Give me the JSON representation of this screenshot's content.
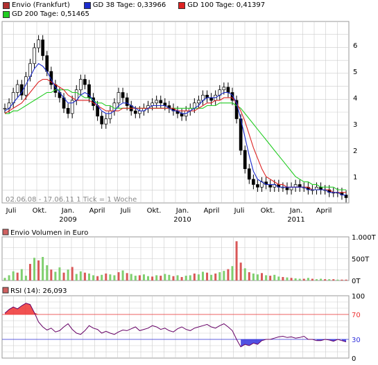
{
  "legend": {
    "row1": [
      {
        "label": "Envio (Frankfurt)",
        "color": "#b03030"
      },
      {
        "label": "GD 38 Tage: 0,33966",
        "color": "#1c2ccd"
      },
      {
        "label": "GD 100 Tage: 0,41397",
        "color": "#dd2222"
      }
    ],
    "row2": [
      {
        "label": "GD 200 Tage: 0,51465",
        "color": "#22cc22"
      }
    ]
  },
  "price_note": "02.06.08 - 17.06.11   1 Tick = 1 Woche",
  "volume_title": "Envio Volumen in Euro",
  "rsi_title": "RSI (14): 26,093",
  "colors": {
    "grid": "#cccccc",
    "border": "#999999",
    "candle": "#000000",
    "gd38": "#1c2ccd",
    "gd100": "#dd2222",
    "gd200": "#22cc22",
    "vol_up": "#7fcf6f",
    "vol_down": "#d95757",
    "rsi": "#660066",
    "rsi_over": "#ee3333",
    "rsi_under": "#3333dd"
  },
  "chart_data": [
    {
      "type": "line",
      "name": "price",
      "x_tick_labels": [
        "Juli",
        "Okt.",
        "Jan.",
        "April",
        "Juli",
        "Okt.",
        "Jan.",
        "April",
        "Juli",
        "Okt.",
        "Jan.",
        "April"
      ],
      "x_year_labels": [
        "2009",
        "2010",
        "2011"
      ],
      "y_ticks": [
        1,
        2,
        3,
        4,
        5,
        6
      ],
      "ylim": [
        0,
        6.9
      ],
      "series": [
        {
          "name": "Envio (Frankfurt)",
          "values": [
            3.6,
            3.8,
            4.2,
            4.5,
            4.1,
            4.8,
            5.3,
            5.9,
            6.2,
            5.6,
            5.0,
            4.5,
            4.2,
            4.0,
            3.6,
            3.4,
            3.9,
            4.3,
            4.7,
            4.5,
            4.0,
            3.7,
            3.3,
            3.0,
            3.2,
            3.5,
            3.8,
            4.2,
            4.0,
            3.7,
            3.5,
            3.4,
            3.5,
            3.6,
            3.7,
            3.8,
            3.9,
            3.8,
            3.7,
            3.6,
            3.5,
            3.4,
            3.3,
            3.5,
            3.6,
            3.8,
            3.9,
            4.1,
            4.0,
            3.9,
            4.1,
            4.3,
            4.4,
            4.2,
            3.9,
            3.2,
            2.0,
            1.3,
            0.9,
            0.7,
            0.6,
            0.8,
            0.7,
            0.6,
            0.7,
            0.6,
            0.6,
            0.5,
            0.6,
            0.7,
            0.6,
            0.6,
            0.5,
            0.5,
            0.6,
            0.5,
            0.5,
            0.4,
            0.4,
            0.4,
            0.3,
            0.2
          ]
        },
        {
          "name": "GD 38 Tage",
          "values": [
            3.5,
            3.6,
            3.8,
            4.0,
            4.2,
            4.5,
            4.8,
            5.1,
            5.3,
            5.2,
            5.0,
            4.7,
            4.4,
            4.2,
            4.0,
            3.8,
            3.8,
            3.9,
            4.1,
            4.2,
            4.1,
            3.9,
            3.7,
            3.5,
            3.4,
            3.4,
            3.5,
            3.7,
            3.8,
            3.8,
            3.7,
            3.6,
            3.5,
            3.5,
            3.6,
            3.7,
            3.7,
            3.7,
            3.7,
            3.6,
            3.5,
            3.5,
            3.4,
            3.4,
            3.5,
            3.6,
            3.7,
            3.9,
            4.0,
            4.0,
            4.0,
            4.1,
            4.2,
            4.2,
            4.1,
            3.8,
            3.2,
            2.5,
            1.8,
            1.2,
            0.9,
            0.8,
            0.7,
            0.7,
            0.7,
            0.6,
            0.6,
            0.6,
            0.6,
            0.6,
            0.6,
            0.6,
            0.5,
            0.5,
            0.5,
            0.5,
            0.5,
            0.4,
            0.4,
            0.4,
            0.3,
            0.3
          ]
        },
        {
          "name": "GD 100 Tage",
          "values": [
            3.4,
            3.5,
            3.6,
            3.7,
            3.8,
            4.0,
            4.2,
            4.4,
            4.6,
            4.7,
            4.7,
            4.6,
            4.5,
            4.4,
            4.3,
            4.1,
            4.0,
            3.9,
            3.9,
            3.9,
            3.9,
            3.8,
            3.7,
            3.6,
            3.5,
            3.5,
            3.5,
            3.5,
            3.6,
            3.6,
            3.6,
            3.6,
            3.6,
            3.6,
            3.6,
            3.6,
            3.6,
            3.6,
            3.6,
            3.6,
            3.6,
            3.5,
            3.5,
            3.5,
            3.5,
            3.5,
            3.6,
            3.7,
            3.8,
            3.8,
            3.9,
            3.9,
            4.0,
            4.0,
            4.0,
            3.8,
            3.5,
            3.1,
            2.6,
            2.1,
            1.7,
            1.3,
            1.0,
            0.9,
            0.8,
            0.7,
            0.7,
            0.6,
            0.6,
            0.6,
            0.6,
            0.6,
            0.6,
            0.5,
            0.5,
            0.5,
            0.5,
            0.5,
            0.4,
            0.4,
            0.4,
            0.4
          ]
        },
        {
          "name": "GD 200 Tage",
          "values": [
            3.4,
            3.4,
            3.5,
            3.5,
            3.6,
            3.7,
            3.8,
            3.9,
            4.0,
            4.1,
            4.2,
            4.2,
            4.3,
            4.3,
            4.3,
            4.3,
            4.2,
            4.2,
            4.1,
            4.0,
            4.0,
            3.9,
            3.8,
            3.8,
            3.7,
            3.7,
            3.6,
            3.6,
            3.6,
            3.6,
            3.6,
            3.6,
            3.6,
            3.6,
            3.6,
            3.6,
            3.6,
            3.6,
            3.6,
            3.6,
            3.6,
            3.6,
            3.6,
            3.6,
            3.6,
            3.6,
            3.6,
            3.6,
            3.7,
            3.7,
            3.7,
            3.8,
            3.8,
            3.8,
            3.8,
            3.7,
            3.6,
            3.4,
            3.2,
            3.0,
            2.8,
            2.6,
            2.4,
            2.2,
            2.0,
            1.8,
            1.6,
            1.4,
            1.2,
            1.0,
            0.9,
            0.8,
            0.8,
            0.7,
            0.7,
            0.6,
            0.6,
            0.6,
            0.6,
            0.5,
            0.5,
            0.5
          ]
        }
      ]
    },
    {
      "type": "bar",
      "name": "volume",
      "y_tick_labels": [
        "1.000T",
        "500T",
        "0T"
      ],
      "ylim": [
        0,
        1000
      ],
      "values": [
        60,
        120,
        210,
        180,
        260,
        110,
        380,
        520,
        460,
        540,
        350,
        250,
        200,
        300,
        180,
        250,
        310,
        150,
        210,
        180,
        160,
        120,
        100,
        130,
        160,
        140,
        120,
        190,
        230,
        170,
        150,
        110,
        120,
        140,
        100,
        90,
        120,
        110,
        150,
        130,
        100,
        120,
        80,
        110,
        120,
        160,
        140,
        200,
        180,
        130,
        160,
        190,
        220,
        260,
        330,
        900,
        410,
        280,
        190,
        160,
        140,
        170,
        120,
        110,
        130,
        90,
        80,
        70,
        60,
        50,
        40,
        40,
        60,
        40,
        30,
        40,
        30,
        30,
        30,
        20,
        20,
        20
      ],
      "up": [
        1,
        1,
        1,
        0,
        1,
        1,
        0,
        1,
        0,
        1,
        1,
        0,
        1,
        1,
        0,
        1,
        0,
        1,
        1,
        0,
        1,
        1,
        0,
        1,
        0,
        1,
        1,
        0,
        1,
        0,
        1,
        1,
        0,
        1,
        1,
        0,
        1,
        0,
        1,
        1,
        0,
        1,
        0,
        1,
        1,
        0,
        1,
        1,
        0,
        1,
        0,
        1,
        1,
        0,
        1,
        0,
        0,
        1,
        0,
        1,
        1,
        0,
        1,
        0,
        1,
        1,
        0,
        1,
        0,
        1,
        1,
        0,
        1,
        0,
        1,
        1,
        0,
        1,
        0,
        1,
        0,
        0
      ]
    },
    {
      "type": "line",
      "name": "rsi",
      "y_ticks": [
        0,
        30,
        70,
        100
      ],
      "ylim": [
        0,
        100
      ],
      "values": [
        72,
        78,
        82,
        79,
        84,
        88,
        86,
        73,
        58,
        50,
        45,
        48,
        42,
        44,
        50,
        55,
        46,
        40,
        38,
        44,
        52,
        48,
        46,
        40,
        43,
        40,
        38,
        42,
        45,
        44,
        47,
        50,
        44,
        46,
        48,
        52,
        50,
        46,
        48,
        44,
        42,
        47,
        50,
        46,
        44,
        48,
        50,
        52,
        54,
        50,
        48,
        52,
        55,
        50,
        44,
        30,
        18,
        22,
        20,
        24,
        22,
        28,
        30,
        30,
        32,
        34,
        35,
        33,
        34,
        32,
        33,
        35,
        30,
        30,
        28,
        28,
        30,
        29,
        27,
        30,
        28,
        26
      ],
      "lines": [
        70,
        30
      ]
    }
  ]
}
